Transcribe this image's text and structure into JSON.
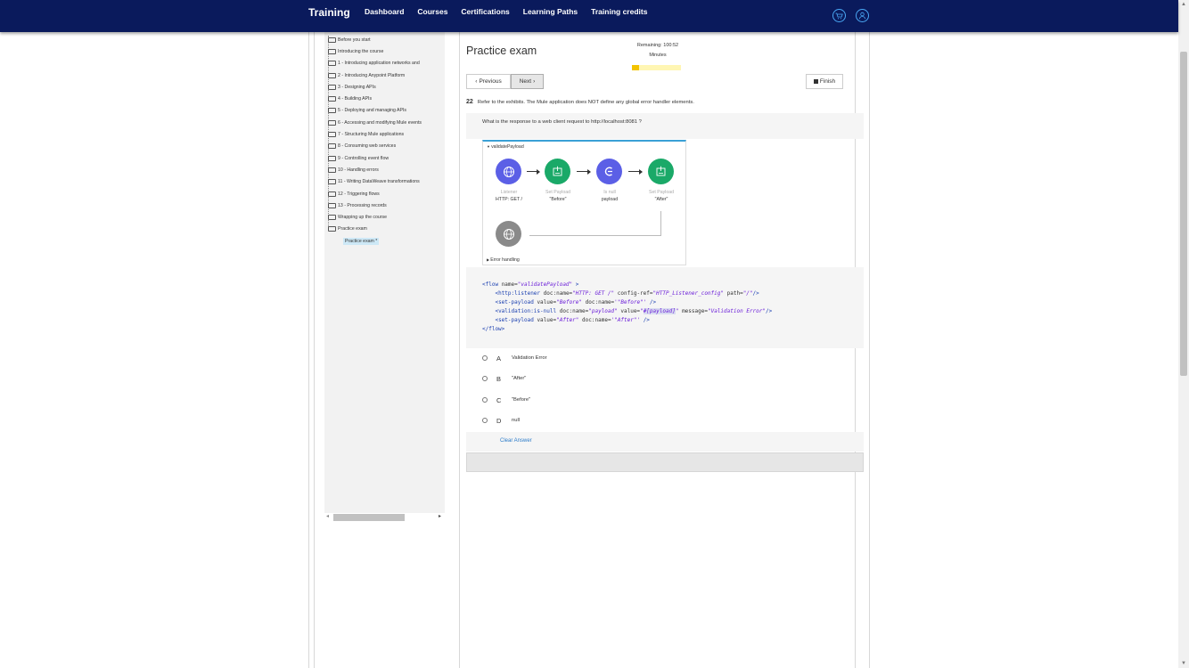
{
  "header": {
    "brand": "Training",
    "nav": [
      "Dashboard",
      "Courses",
      "Certifications",
      "Learning Paths",
      "Training credits"
    ],
    "colors": {
      "bar": "#0a1a5c",
      "accent": "#4aa8f5"
    },
    "icons": [
      "cart-icon",
      "user-icon"
    ]
  },
  "sidebar": {
    "items": [
      "Before you start",
      "Introducing the course",
      "1 - Introducing application networks and",
      "2 - Introducing Anypoint Platform",
      "3 - Designing APIs",
      "4 - Building APIs",
      "5 - Deploying and managing APIs",
      "6 - Accessing and modifying Mule events",
      "7 - Structuring Mule applications",
      "8 - Consuming web services",
      "9 - Controlling event flow",
      "10 - Handling errors",
      "11 - Writing DataWeave transformations",
      "12 - Triggering flows",
      "13 - Processing records",
      "Wrapping up the course",
      "Practice exam"
    ],
    "active_item": "Practice exam *"
  },
  "exam": {
    "title": "Practice exam",
    "remaining_label": "Remaining: 100:52",
    "minutes_label": "Minutes",
    "time_progress": 0.15,
    "prev_label": "Previous",
    "next_label": "Next",
    "finish_label": "Finish",
    "question_number": "22",
    "question_text": "Refer to the exhibits. The Mule application does NOT define any global error handler elements.",
    "prompt": "What is the response to a web client request to http://localhost:8081 ?",
    "clear_label": "Clear Answer"
  },
  "diagram": {
    "flow_name": "validatePayload",
    "nodes": [
      {
        "type": "Listener",
        "label": "HTTP: GET /",
        "color": "#5b5fe6",
        "icon": "globe-icon"
      },
      {
        "type": "Set Payload",
        "label": "\"Before\"",
        "color": "#1aa968",
        "icon": "set-payload-icon"
      },
      {
        "type": "Is null",
        "label": "payload",
        "color": "#5b5fe6",
        "icon": "validation-icon"
      },
      {
        "type": "Set Payload",
        "label": "\"After\"",
        "color": "#1aa968",
        "icon": "set-payload-icon"
      }
    ],
    "error_handling": "Error handling"
  },
  "code": {
    "l1_tag": "<flow",
    "l1_attr": "name=",
    "l1_val": "\"validatePayload\"",
    "l1_end": " >",
    "l2_tag": "<http:listener",
    "l2_a1": "doc:name=",
    "l2_v1": "\"HTTP: GET /\"",
    "l2_a2": "config-ref=",
    "l2_v2": "\"HTTP_Listener_config\"",
    "l2_a3": "path=",
    "l2_v3": "\"/\"",
    "l2_end": "/>",
    "l3_tag": "<set-payload",
    "l3_a1": "value=",
    "l3_v1": "\"Before\"",
    "l3_a2": "doc:name=",
    "l3_v2": "'\"Before\"'",
    "l3_end": " />",
    "l4_tag": "<validation:is-null",
    "l4_a1": "doc:name=",
    "l4_v1": "\"payload\"",
    "l4_a2": "value=",
    "l4_v2a": "\"",
    "l4_v2b": "#[payload]",
    "l4_v2c": "\"",
    "l4_a3": "message=",
    "l4_v3": "\"Validation Error\"",
    "l4_end": "/>",
    "l5_tag": "<set-payload",
    "l5_a1": "value=",
    "l5_v1": "\"After\"",
    "l5_a2": "doc:name=",
    "l5_v2": "'\"After\"'",
    "l5_end": " />",
    "l6_tag": "</flow>"
  },
  "options": [
    {
      "letter": "A",
      "text": "Validation Error"
    },
    {
      "letter": "B",
      "text": "\"After\""
    },
    {
      "letter": "C",
      "text": "\"Before\""
    },
    {
      "letter": "D",
      "text": "null"
    }
  ]
}
